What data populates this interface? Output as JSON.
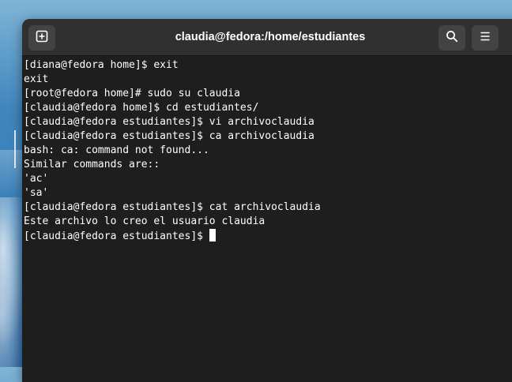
{
  "window": {
    "title": "claudia@fedora:/home/estudiantes"
  },
  "toolbar": {
    "new_tab_icon": "new-tab-icon",
    "search_icon": "search-icon",
    "menu_icon": "hamburger-menu-icon"
  },
  "terminal": {
    "lines": [
      "[diana@fedora home]$ exit",
      "exit",
      "[root@fedora home]# sudo su claudia",
      "[claudia@fedora home]$ cd estudiantes/",
      "[claudia@fedora estudiantes]$ vi archivoclaudia",
      "[claudia@fedora estudiantes]$ ca archivoclaudia",
      "bash: ca: command not found...",
      "Similar commands are::",
      "'ac'",
      "'sa'",
      "[claudia@fedora estudiantes]$ cat archivoclaudia",
      "Este archivo lo creo el usuario claudia"
    ],
    "prompt": "[claudia@fedora estudiantes]$ "
  }
}
